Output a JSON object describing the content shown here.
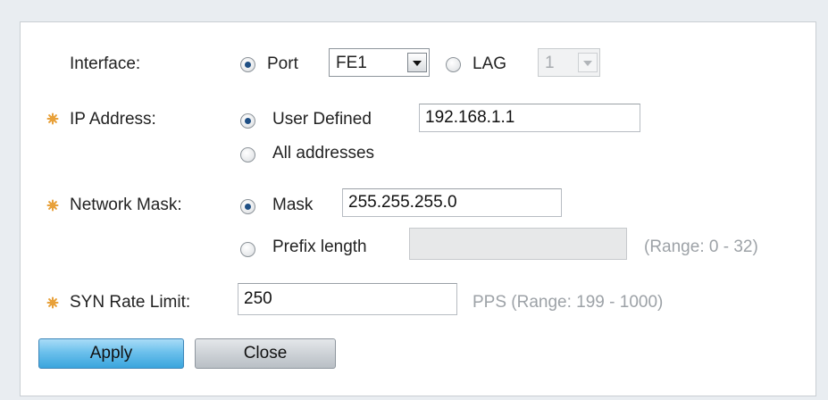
{
  "interface": {
    "label": "Interface:",
    "port_label": "Port",
    "port_selected": true,
    "port_value": "FE1",
    "lag_label": "LAG",
    "lag_selected": false,
    "lag_value": "1"
  },
  "ip_address": {
    "label": "IP Address:",
    "required": true,
    "user_defined_label": "User Defined",
    "user_defined_selected": true,
    "value": "192.168.1.1",
    "all_addresses_label": "All addresses",
    "all_addresses_selected": false
  },
  "network_mask": {
    "label": "Network Mask:",
    "required": true,
    "mask_label": "Mask",
    "mask_selected": true,
    "mask_value": "255.255.255.0",
    "prefix_label": "Prefix length",
    "prefix_selected": false,
    "prefix_value": "",
    "prefix_hint": "(Range: 0 - 32)"
  },
  "syn_rate_limit": {
    "label": "SYN Rate Limit:",
    "required": true,
    "value": "250",
    "hint": "PPS (Range: 199 - 1000)"
  },
  "buttons": {
    "apply": "Apply",
    "close": "Close"
  },
  "colors": {
    "required_star": "#e8a13a",
    "apply_button": "#4fb2e5",
    "close_button": "#c9ced3",
    "radio_dot": "#1f4f84"
  },
  "icons": {
    "required": "required-star-icon",
    "dropdown": "chevron-down-icon"
  }
}
